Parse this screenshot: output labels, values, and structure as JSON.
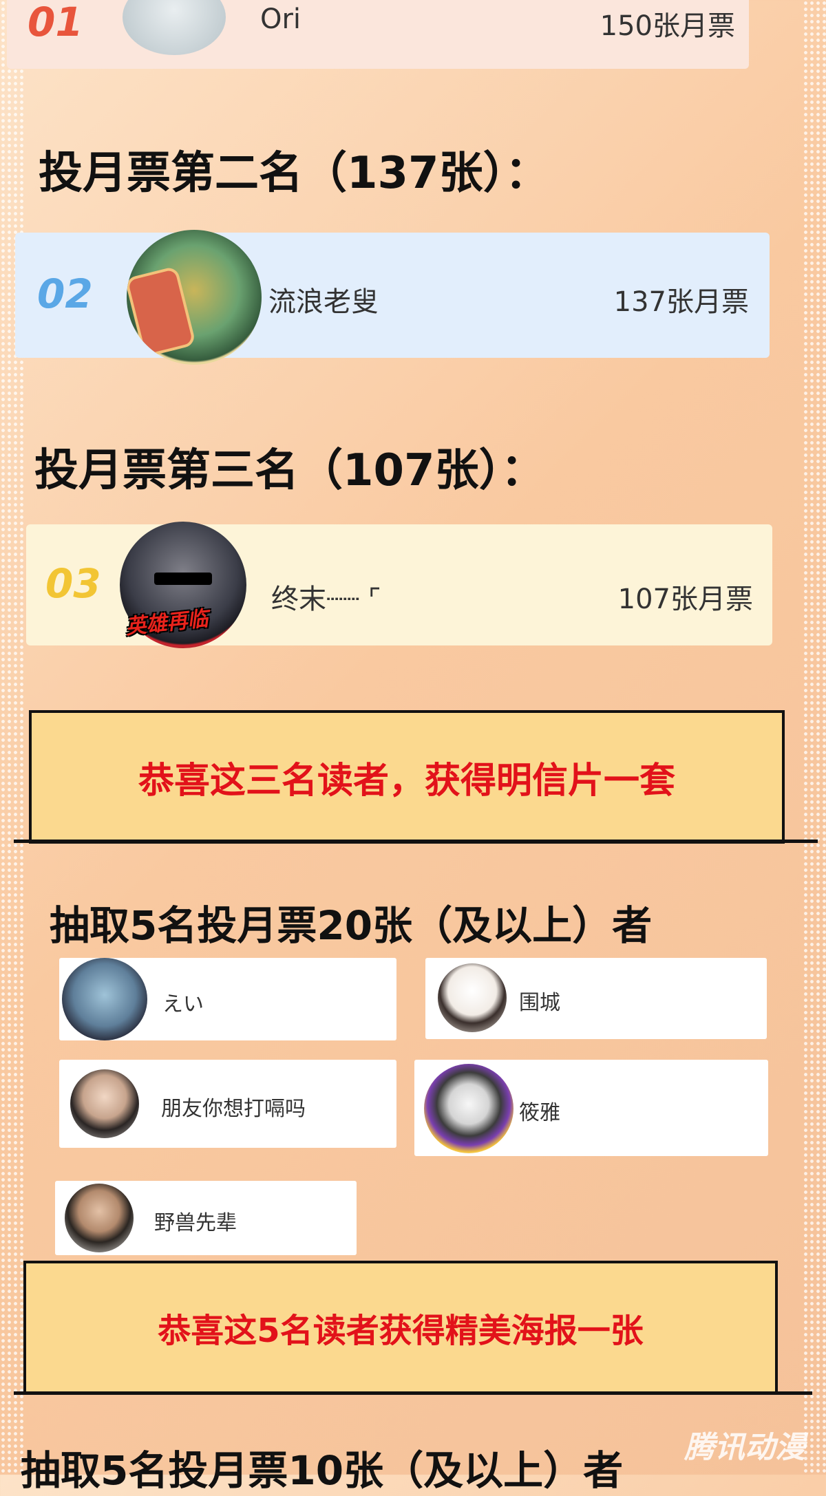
{
  "colors": {
    "rank1": "#e8553c",
    "rank2": "#5aa7e6",
    "rank3": "#f2c534",
    "banner_text": "#e2121a",
    "banner_bg": "#fbd98f"
  },
  "rank1": {
    "num": "01",
    "name": "Ori",
    "votes": "150张月票"
  },
  "heading2": "投月票第二名（137张）：",
  "rank2": {
    "num": "02",
    "name": "流浪老叟",
    "votes": "137张月票"
  },
  "heading3": "投月票第三名（107张）：",
  "rank3": {
    "num": "03",
    "name": "终末┈┈ ⌜",
    "votes": "107张月票",
    "badge_text": "英雄再临"
  },
  "banner1": "恭喜这三名读者，获得明信片一套",
  "heading4": "抽取5名投月票20张（及以上）者",
  "users": [
    {
      "name": "えい"
    },
    {
      "name": "围城"
    },
    {
      "name": "朋友你想打嗝吗"
    },
    {
      "name": "筱雅"
    },
    {
      "name": "野兽先辈"
    }
  ],
  "banner2": "恭喜这5名读者获得精美海报一张",
  "heading5": "抽取5名投月票10张（及以上）者",
  "watermark": "腾讯动漫"
}
